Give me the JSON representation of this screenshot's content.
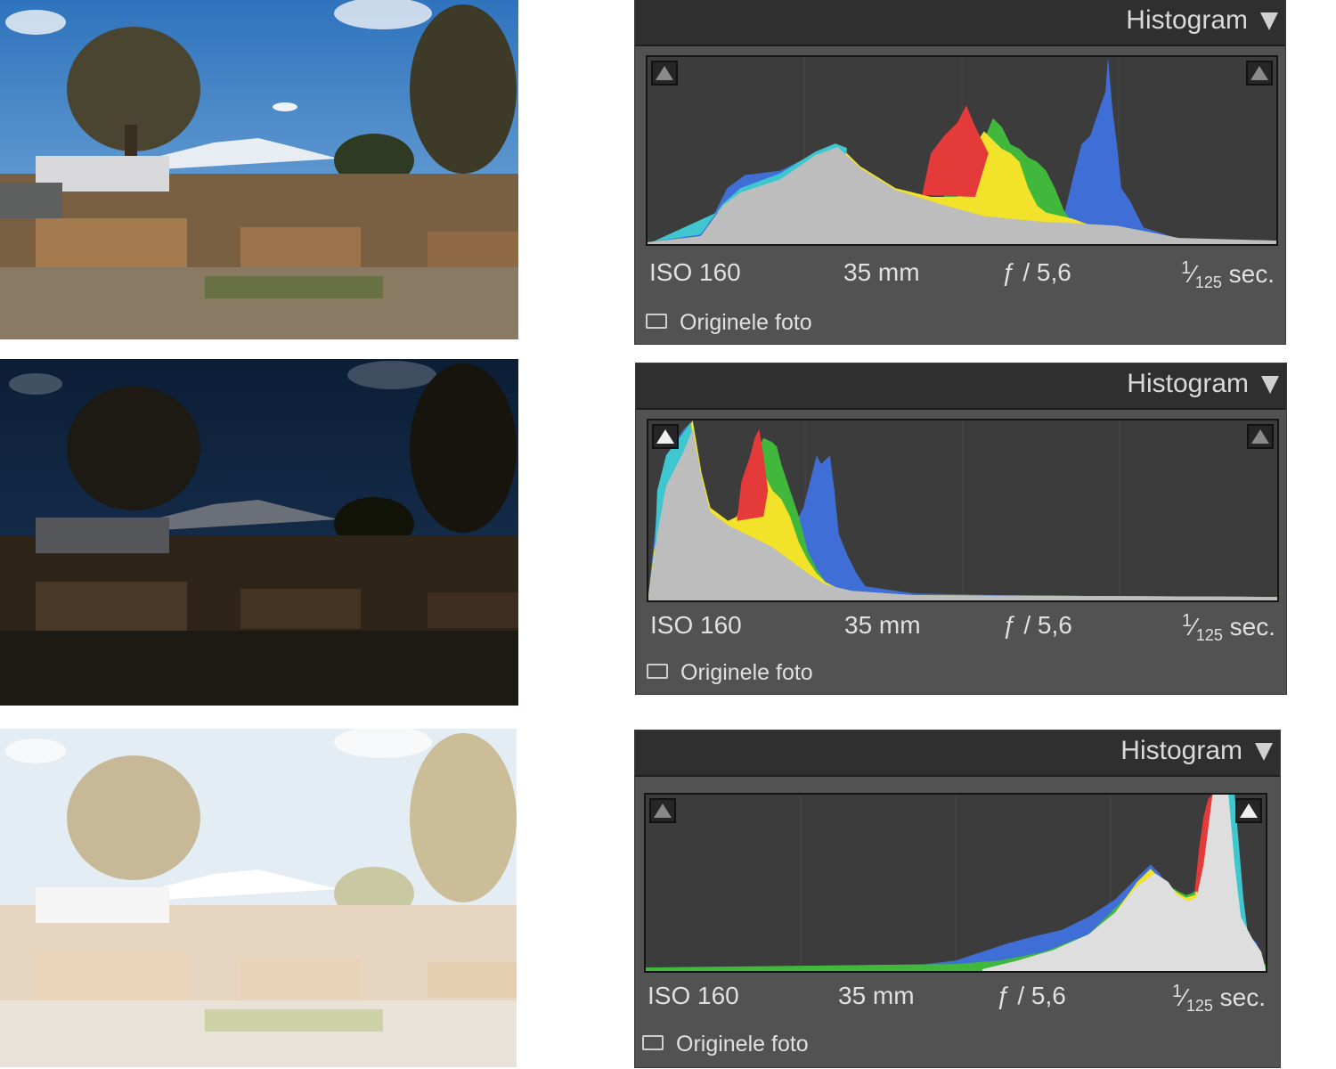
{
  "colors": {
    "panel_bg": "#525252",
    "header_bg": "#2f2f2f",
    "histogram_bg": "#3c3c3c",
    "gray_channel": "#bdbdbd",
    "red_channel": "#e53a3a",
    "yellow_channel": "#f2e22a",
    "green_channel": "#41b83c",
    "cyan_channel": "#3fc7d0",
    "blue_channel": "#3f6fd6"
  },
  "photos": [
    {
      "exposure": "normal"
    },
    {
      "exposure": "underexposed"
    },
    {
      "exposure": "overexposed"
    }
  ],
  "panels": [
    {
      "title": "Histogram",
      "clip_shadows": "inactive",
      "clip_highlights": "inactive",
      "iso": "ISO 160",
      "focal": "35 mm",
      "aperture": "ƒ / 5,6",
      "shutter_num": "1",
      "shutter_den": "125",
      "shutter_unit": " sec.",
      "original_photo_label": "Originele foto"
    },
    {
      "title": "Histogram",
      "clip_shadows": "active",
      "clip_highlights": "inactive",
      "iso": "ISO 160",
      "focal": "35 mm",
      "aperture": "ƒ / 5,6",
      "shutter_num": "1",
      "shutter_den": "125",
      "shutter_unit": " sec.",
      "original_photo_label": "Originele foto"
    },
    {
      "title": "Histogram",
      "clip_shadows": "inactive",
      "clip_highlights": "active",
      "iso": "ISO 160",
      "focal": "35 mm",
      "aperture": "ƒ / 5,6",
      "shutter_num": "1",
      "shutter_den": "125",
      "shutter_unit": " sec.",
      "original_photo_label": "Originele foto"
    }
  ]
}
